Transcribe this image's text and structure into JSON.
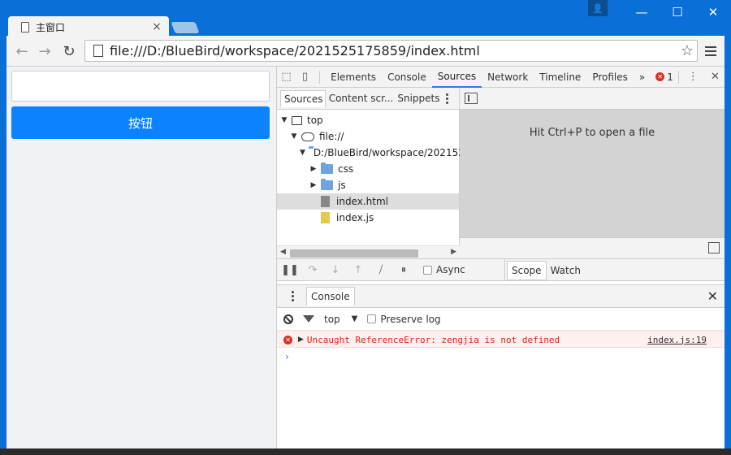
{
  "window": {
    "tab_title": "主窗口",
    "tab_close": "×",
    "user_glyph": "👤",
    "minimize": "—",
    "maximize": "☐",
    "close": "✕"
  },
  "toolbar": {
    "back": "←",
    "forward": "→",
    "reload": "↻",
    "url": "file:///D:/BlueBird/workspace/2021525175859/index.html",
    "star": "☆"
  },
  "page": {
    "input_value": "",
    "button_label": "按钮"
  },
  "devtools": {
    "inspect_icon": "⬚",
    "device_icon": "▯",
    "tabs": [
      "Elements",
      "Console",
      "Sources",
      "Network",
      "Timeline",
      "Profiles"
    ],
    "active_tab": "Sources",
    "more": "»",
    "error_count": "1",
    "error_glyph": "✕",
    "kebab": "⋮",
    "close": "✕",
    "nav_tabs": [
      "Sources",
      "Content scr...",
      "Snippets"
    ],
    "tree": [
      {
        "label": "top",
        "type": "frame",
        "expander": "▼"
      },
      {
        "label": "file://",
        "type": "cloud",
        "expander": "▼"
      },
      {
        "label": "D:/BlueBird/workspace/202152",
        "type": "folder",
        "expander": "▼"
      },
      {
        "label": "css",
        "type": "folder",
        "expander": "▶"
      },
      {
        "label": "js",
        "type": "folder",
        "expander": "▶"
      },
      {
        "label": "index.html",
        "type": "html",
        "expander": ""
      },
      {
        "label": "index.js",
        "type": "js",
        "expander": ""
      }
    ],
    "scroll_left": "◀",
    "scroll_right": "▶",
    "editor_hint": "Hit Ctrl+P to open a file",
    "debugger": {
      "pause": "❚❚",
      "step_over": "↷",
      "step_into": "↓",
      "step_out": "↑",
      "deactivate": "⧸",
      "pause_exceptions": "⏸",
      "async_label": "Async"
    },
    "scope_tabs": [
      "Scope",
      "Watch"
    ],
    "drawer": {
      "tab": "Console",
      "context": "top",
      "context_arrow": "▼",
      "preserve_log": "Preserve log",
      "error_message": "Uncaught ReferenceError: zengjia is not defined",
      "error_expander": "▶",
      "error_source": "index.js:19",
      "prompt": "›"
    }
  }
}
